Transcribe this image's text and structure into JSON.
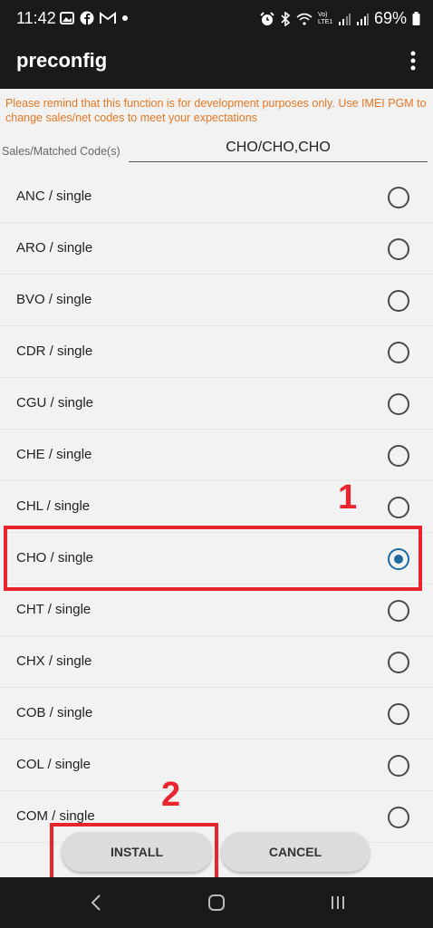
{
  "status_bar": {
    "time": "11:42",
    "battery": "69%",
    "volte": "Vo) LTE1"
  },
  "appbar": {
    "title": "preconfig"
  },
  "warning_text": "Please remind that this function is for development purposes only. Use IMEI PGM to change sales/net codes to meet your expectations",
  "sales_field": {
    "label": "Sales/Matched Code(s)",
    "value": "CHO/CHO,CHO"
  },
  "items": [
    {
      "label": "ANC / single",
      "selected": false
    },
    {
      "label": "ARO / single",
      "selected": false
    },
    {
      "label": "BVO / single",
      "selected": false
    },
    {
      "label": "CDR / single",
      "selected": false
    },
    {
      "label": "CGU / single",
      "selected": false
    },
    {
      "label": "CHE / single",
      "selected": false
    },
    {
      "label": "CHL / single",
      "selected": false
    },
    {
      "label": "CHO / single",
      "selected": true
    },
    {
      "label": "CHT / single",
      "selected": false
    },
    {
      "label": "CHX / single",
      "selected": false
    },
    {
      "label": "COB / single",
      "selected": false
    },
    {
      "label": "COL / single",
      "selected": false
    },
    {
      "label": "COM / single",
      "selected": false
    }
  ],
  "buttons": {
    "install": "INSTALL",
    "cancel": "CANCEL"
  },
  "annotations": {
    "step1": "1",
    "step2": "2"
  },
  "colors": {
    "accent": "#1c6aa0",
    "warning": "#e87722",
    "annotation": "#e8242c"
  }
}
